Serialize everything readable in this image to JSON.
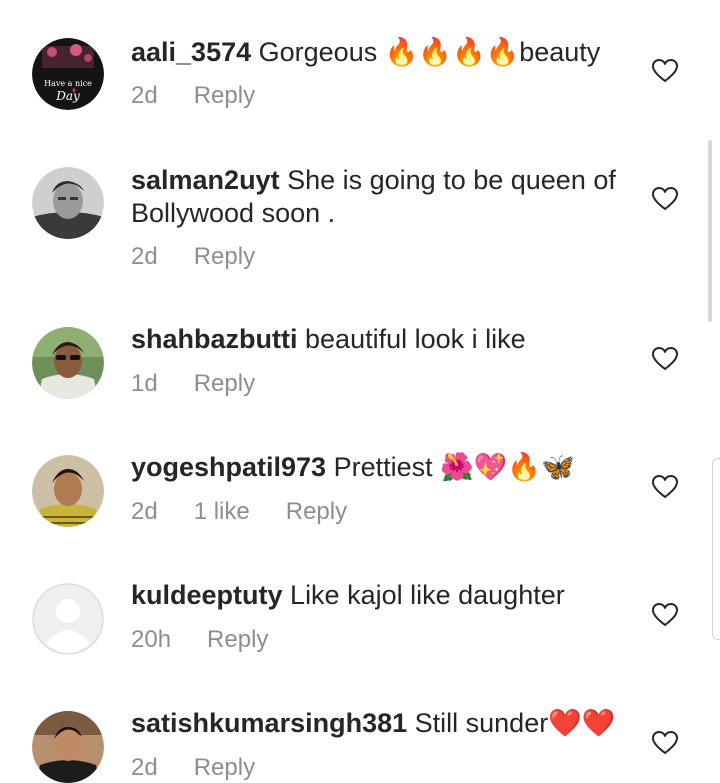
{
  "comments": [
    {
      "username": "aali_3574",
      "text": "Gorgeous 🔥🔥🔥🔥beauty",
      "time": "2d",
      "likes": "",
      "reply": "Reply"
    },
    {
      "username": "salman2uyt",
      "text": "She is going to be queen of Bollywood soon .",
      "time": "2d",
      "likes": "",
      "reply": "Reply"
    },
    {
      "username": "shahbazbutti",
      "text": "beautiful look i like",
      "time": "1d",
      "likes": "",
      "reply": "Reply"
    },
    {
      "username": "yogeshpatil973",
      "text": "Prettiest 🌺💖🔥🦋",
      "time": "2d",
      "likes": "1 like",
      "reply": "Reply"
    },
    {
      "username": "kuldeeptuty",
      "text": "Like kajol like daughter",
      "time": "20h",
      "likes": "",
      "reply": "Reply"
    },
    {
      "username": "satishkumarsingh381",
      "text": "Still sunder❤️❤️",
      "time": "2d",
      "likes": "",
      "reply": "Reply"
    }
  ],
  "avatar_text": {
    "line1": "Have a nice",
    "line2": "Day"
  },
  "colors": {
    "text": "#262626",
    "meta": "#8e8e8e",
    "heart_stroke": "#262626"
  }
}
